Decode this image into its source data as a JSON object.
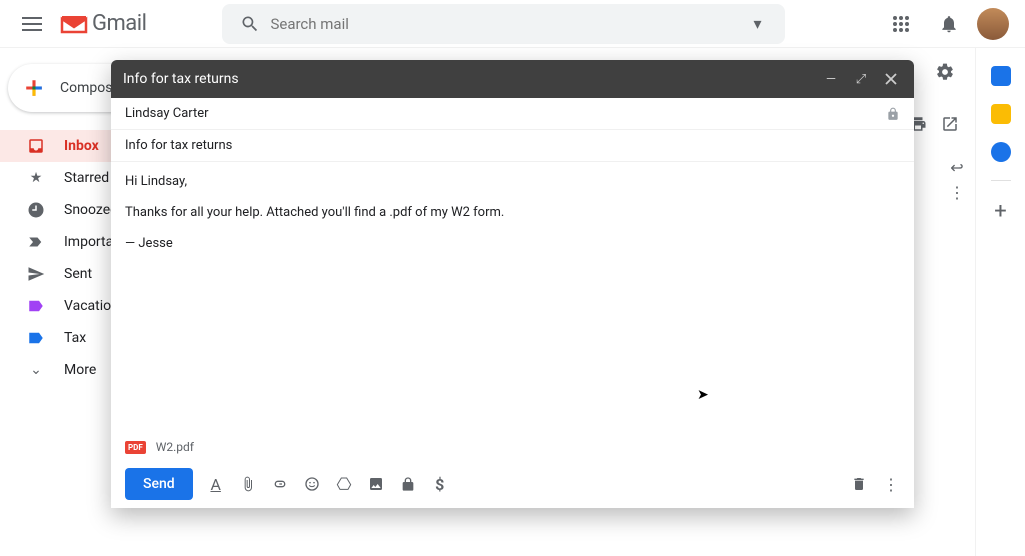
{
  "header": {
    "app_name": "Gmail",
    "search_placeholder": "Search mail"
  },
  "sidebar": {
    "compose_label": "Compose",
    "items": [
      {
        "label": "Inbox",
        "icon": "inbox-icon",
        "active": true
      },
      {
        "label": "Starred",
        "icon": "star-icon"
      },
      {
        "label": "Snoozed",
        "icon": "clock-icon"
      },
      {
        "label": "Important",
        "icon": "important-icon"
      },
      {
        "label": "Sent",
        "icon": "sent-icon"
      },
      {
        "label": "Vacation",
        "icon": "label-icon",
        "color": "purple"
      },
      {
        "label": "Tax",
        "icon": "label-icon",
        "color": "blue"
      },
      {
        "label": "More",
        "icon": "chevron-down-icon"
      }
    ]
  },
  "compose": {
    "header_title": "Info for tax returns",
    "recipient": "Lindsay Carter",
    "subject": "Info for tax returns",
    "body_line1": "Hi Lindsay,",
    "body_line2": "Thanks for all your help. Attached you'll find a .pdf of my W2 form.",
    "body_sign": "— Jesse",
    "attachment_name": "W2.pdf",
    "attachment_badge": "PDF",
    "send_label": "Send"
  }
}
